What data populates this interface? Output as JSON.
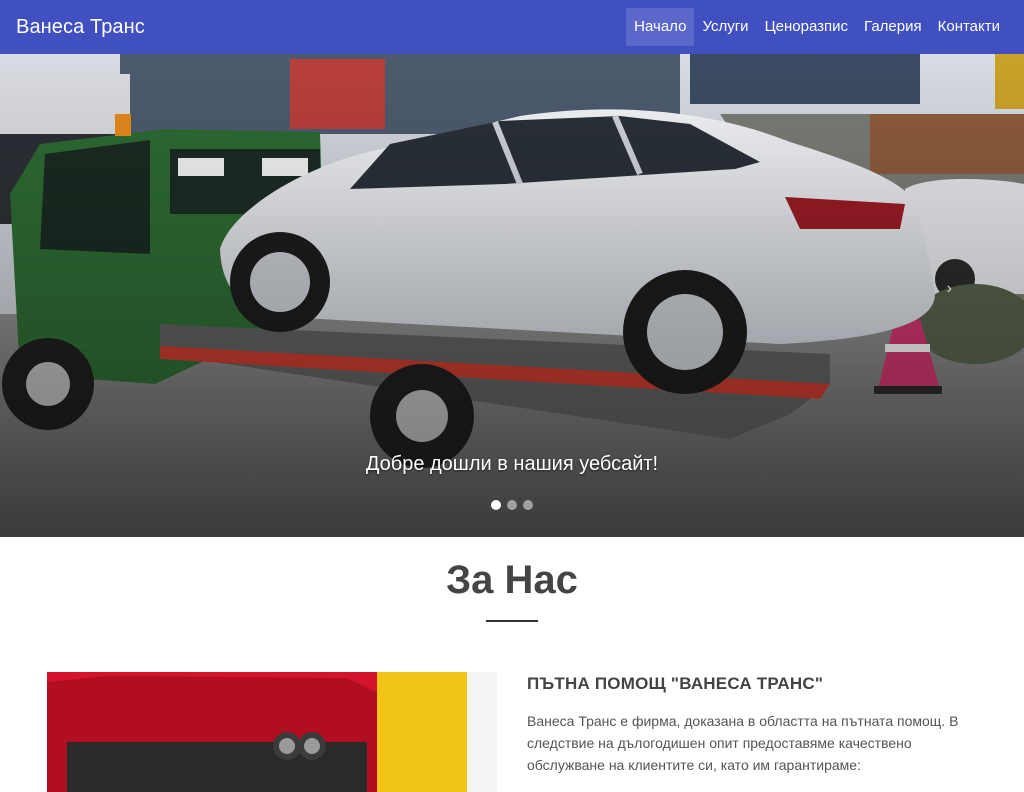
{
  "navbar": {
    "brand": "Ванеса Транс",
    "items": [
      {
        "label": "Начало",
        "active": true
      },
      {
        "label": "Услуги"
      },
      {
        "label": "Ценоразпис"
      },
      {
        "label": "Галерия"
      },
      {
        "label": "Контакти"
      }
    ],
    "color": "#4150c0"
  },
  "hero": {
    "caption": "Добре дошли в нашия уебсайт!",
    "slides": 3,
    "active_slide": 1,
    "next_icon": "chevron-right-icon"
  },
  "about": {
    "title": "За Нас",
    "heading": "ПЪТНА ПОМОЩ \"ВАНЕСА ТРАНС\"",
    "body": "Ванеса Транс е фирма, доказана в областта на пътната помощ. В следствие на дълогодишен опит предоставяме качествено обслужване на клиентите си, като им гарантираме:"
  }
}
